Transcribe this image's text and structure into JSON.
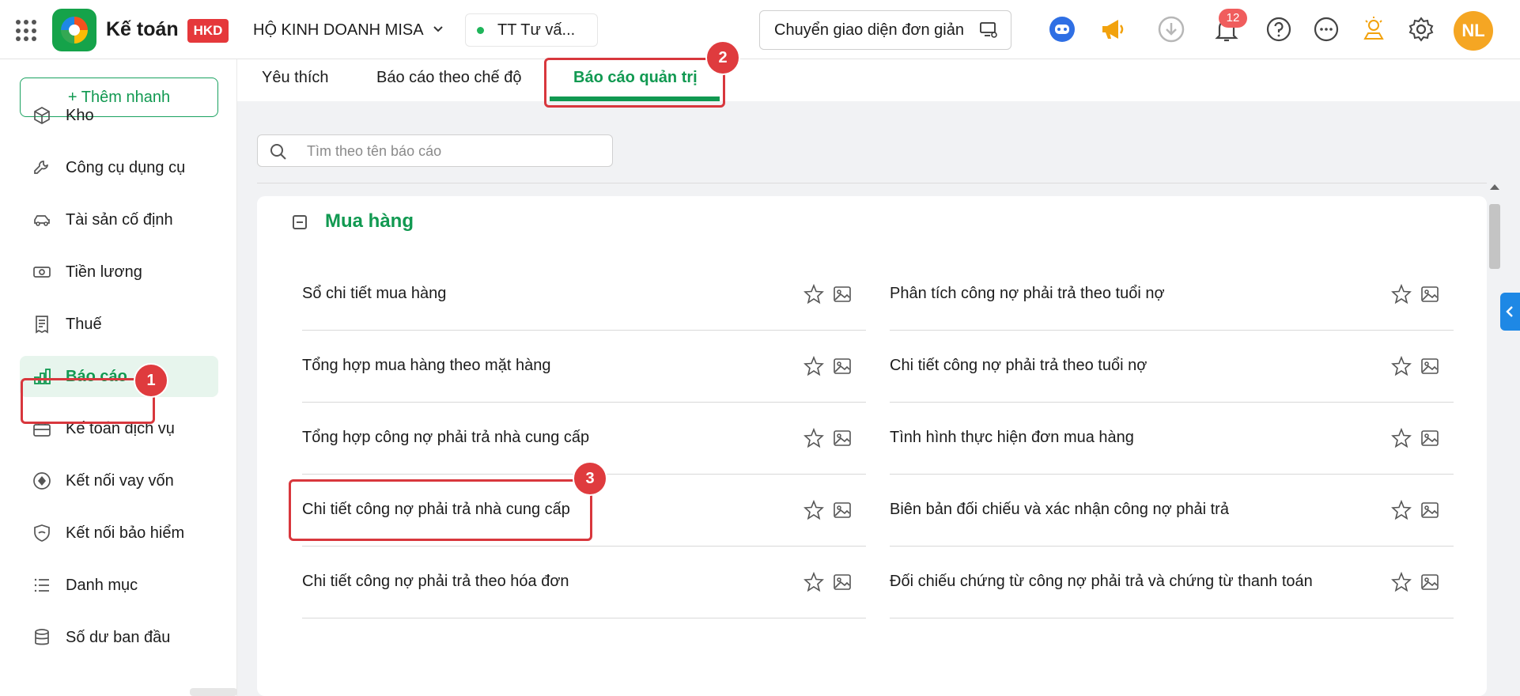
{
  "app": {
    "name": "Kế toán",
    "badge": "HKD",
    "company": "HỘ KINH DOANH MISA",
    "branch": "TT Tư vấ...",
    "switch_label": "Chuyển giao diện đơn giản",
    "notification_count": "12",
    "avatar_initials": "NL"
  },
  "sidebar": {
    "quick_add": "+ Thêm nhanh",
    "items": [
      {
        "label": "Kho",
        "icon": "box-icon"
      },
      {
        "label": "Công cụ dụng cụ",
        "icon": "wrench-icon"
      },
      {
        "label": "Tài sản cố định",
        "icon": "car-icon"
      },
      {
        "label": "Tiền lương",
        "icon": "money-icon"
      },
      {
        "label": "Thuế",
        "icon": "receipt-icon"
      },
      {
        "label": "Báo cáo",
        "icon": "bar-chart-icon",
        "active": true
      },
      {
        "label": "Kế toán dịch vụ",
        "icon": "briefcase-icon"
      },
      {
        "label": "Kết nối vay vốn",
        "icon": "loan-icon"
      },
      {
        "label": "Kết nối bảo hiểm",
        "icon": "shield-icon"
      },
      {
        "label": "Danh mục",
        "icon": "list-icon"
      },
      {
        "label": "Số dư ban đầu",
        "icon": "database-icon"
      }
    ]
  },
  "tabs": [
    {
      "label": "Yêu thích"
    },
    {
      "label": "Báo cáo theo chế độ"
    },
    {
      "label": "Báo cáo quản trị",
      "active": true
    }
  ],
  "search": {
    "placeholder": "Tìm theo tên báo cáo"
  },
  "group": {
    "title": "Mua hàng",
    "left_reports": [
      "Sổ chi tiết mua hàng",
      "Tổng hợp mua hàng theo mặt hàng",
      "Tổng hợp công nợ phải trả nhà cung cấp",
      "Chi tiết công nợ phải trả nhà cung cấp",
      "Chi tiết công nợ phải trả theo hóa đơn"
    ],
    "right_reports": [
      "Phân tích công nợ phải trả theo tuổi nợ",
      "Chi tiết công nợ phải trả theo tuổi nợ",
      "Tình hình thực hiện đơn mua hàng",
      "Biên bản đối chiếu và xác nhận công nợ phải trả",
      "Đối chiếu chứng từ công nợ phải trả và chứng từ thanh toán"
    ]
  },
  "annotations": {
    "step1": "1",
    "step2": "2",
    "step3": "3"
  },
  "colors": {
    "primary": "#119951",
    "highlight": "#d8373d",
    "badge": "#e5383b",
    "avatar": "#f5a623"
  }
}
